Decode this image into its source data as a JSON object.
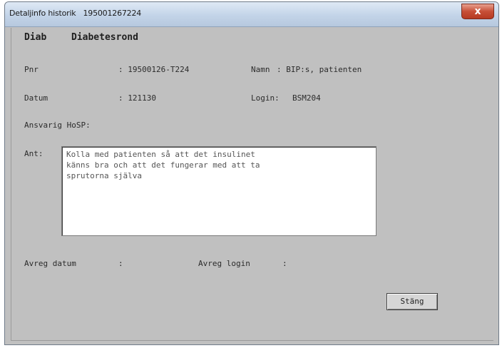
{
  "window": {
    "title_prefix": "Detaljinfo historik",
    "title_id": "195001267224",
    "close_label": "x"
  },
  "header": {
    "module": "Diab",
    "name": "Diabetesrond"
  },
  "fields": {
    "pnr_label": "Pnr",
    "pnr_value": ": 19500126-T224",
    "namn_label": "Namn",
    "namn_value": ": BIP:s, patienten",
    "datum_label": "Datum",
    "datum_value": ": 121130",
    "login_label": "Login:",
    "login_value": "BSM204",
    "ansvarig_label": "Ansvarig HoSP:",
    "ant_label": "Ant:",
    "ant_text": "Kolla med patienten så att det insulinet\nkänns bra och att det fungerar med att ta\nsprutorna själva",
    "avreg_datum_label": "Avreg datum",
    "avreg_datum_value": ":",
    "avreg_login_label": "Avreg login",
    "avreg_login_value": ":"
  },
  "buttons": {
    "close_label": "Stäng"
  }
}
